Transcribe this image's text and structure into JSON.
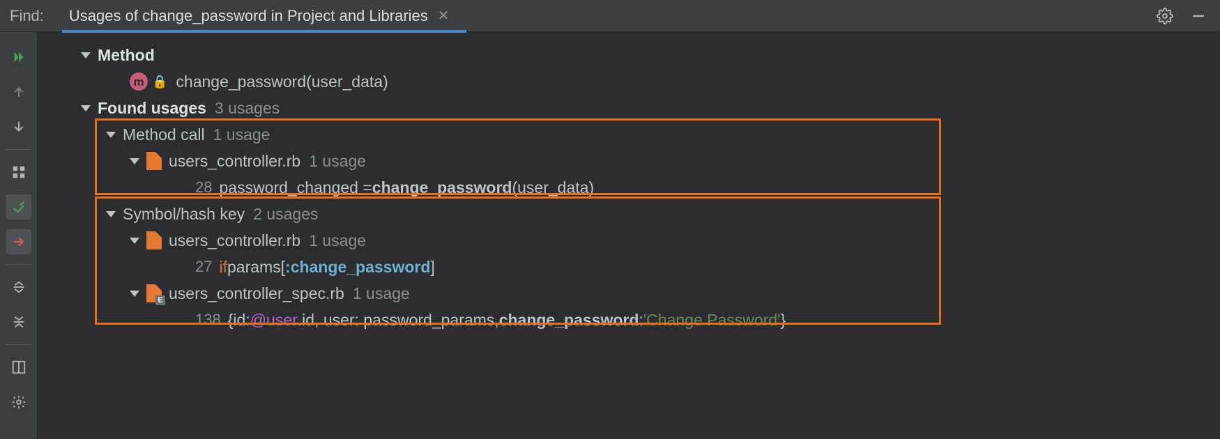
{
  "topbar": {
    "label": "Find:",
    "tab_title": "Usages of change_password in Project and Libraries"
  },
  "tree": {
    "method_header": "Method",
    "method_badge": "m",
    "method_signature": "change_password(user_data)",
    "found_usages_label": "Found usages",
    "found_usages_count": "3 usages",
    "groups": [
      {
        "title": "Method call",
        "count": "1 usage",
        "files": [
          {
            "name": "users_controller.rb",
            "count": "1 usage",
            "spec": false,
            "lines": [
              {
                "num": "28",
                "tokens": [
                  {
                    "t": "password_changed = ",
                    "cls": "code"
                  },
                  {
                    "t": "change_password",
                    "cls": "bold code"
                  },
                  {
                    "t": "(user_data)",
                    "cls": "code"
                  }
                ]
              }
            ]
          }
        ]
      },
      {
        "title": "Symbol/hash key",
        "count": "2 usages",
        "files": [
          {
            "name": "users_controller.rb",
            "count": "1 usage",
            "spec": false,
            "lines": [
              {
                "num": "27",
                "tokens": [
                  {
                    "t": "if ",
                    "cls": "kw"
                  },
                  {
                    "t": "params[",
                    "cls": "code"
                  },
                  {
                    "t": ":change_password",
                    "cls": "sym"
                  },
                  {
                    "t": "]",
                    "cls": "code"
                  }
                ]
              }
            ]
          },
          {
            "name": "users_controller_spec.rb",
            "count": "1 usage",
            "spec": true,
            "lines": [
              {
                "num": "138",
                "tokens": [
                  {
                    "t": "{id: ",
                    "cls": "code"
                  },
                  {
                    "t": "@user",
                    "cls": "ivar"
                  },
                  {
                    "t": ".id, user: password_params, ",
                    "cls": "code"
                  },
                  {
                    "t": "change_password",
                    "cls": "bold code"
                  },
                  {
                    "t": ": ",
                    "cls": "code"
                  },
                  {
                    "t": "'Change Password'",
                    "cls": "str"
                  },
                  {
                    "t": "}",
                    "cls": "code"
                  }
                ]
              }
            ]
          }
        ]
      }
    ]
  }
}
